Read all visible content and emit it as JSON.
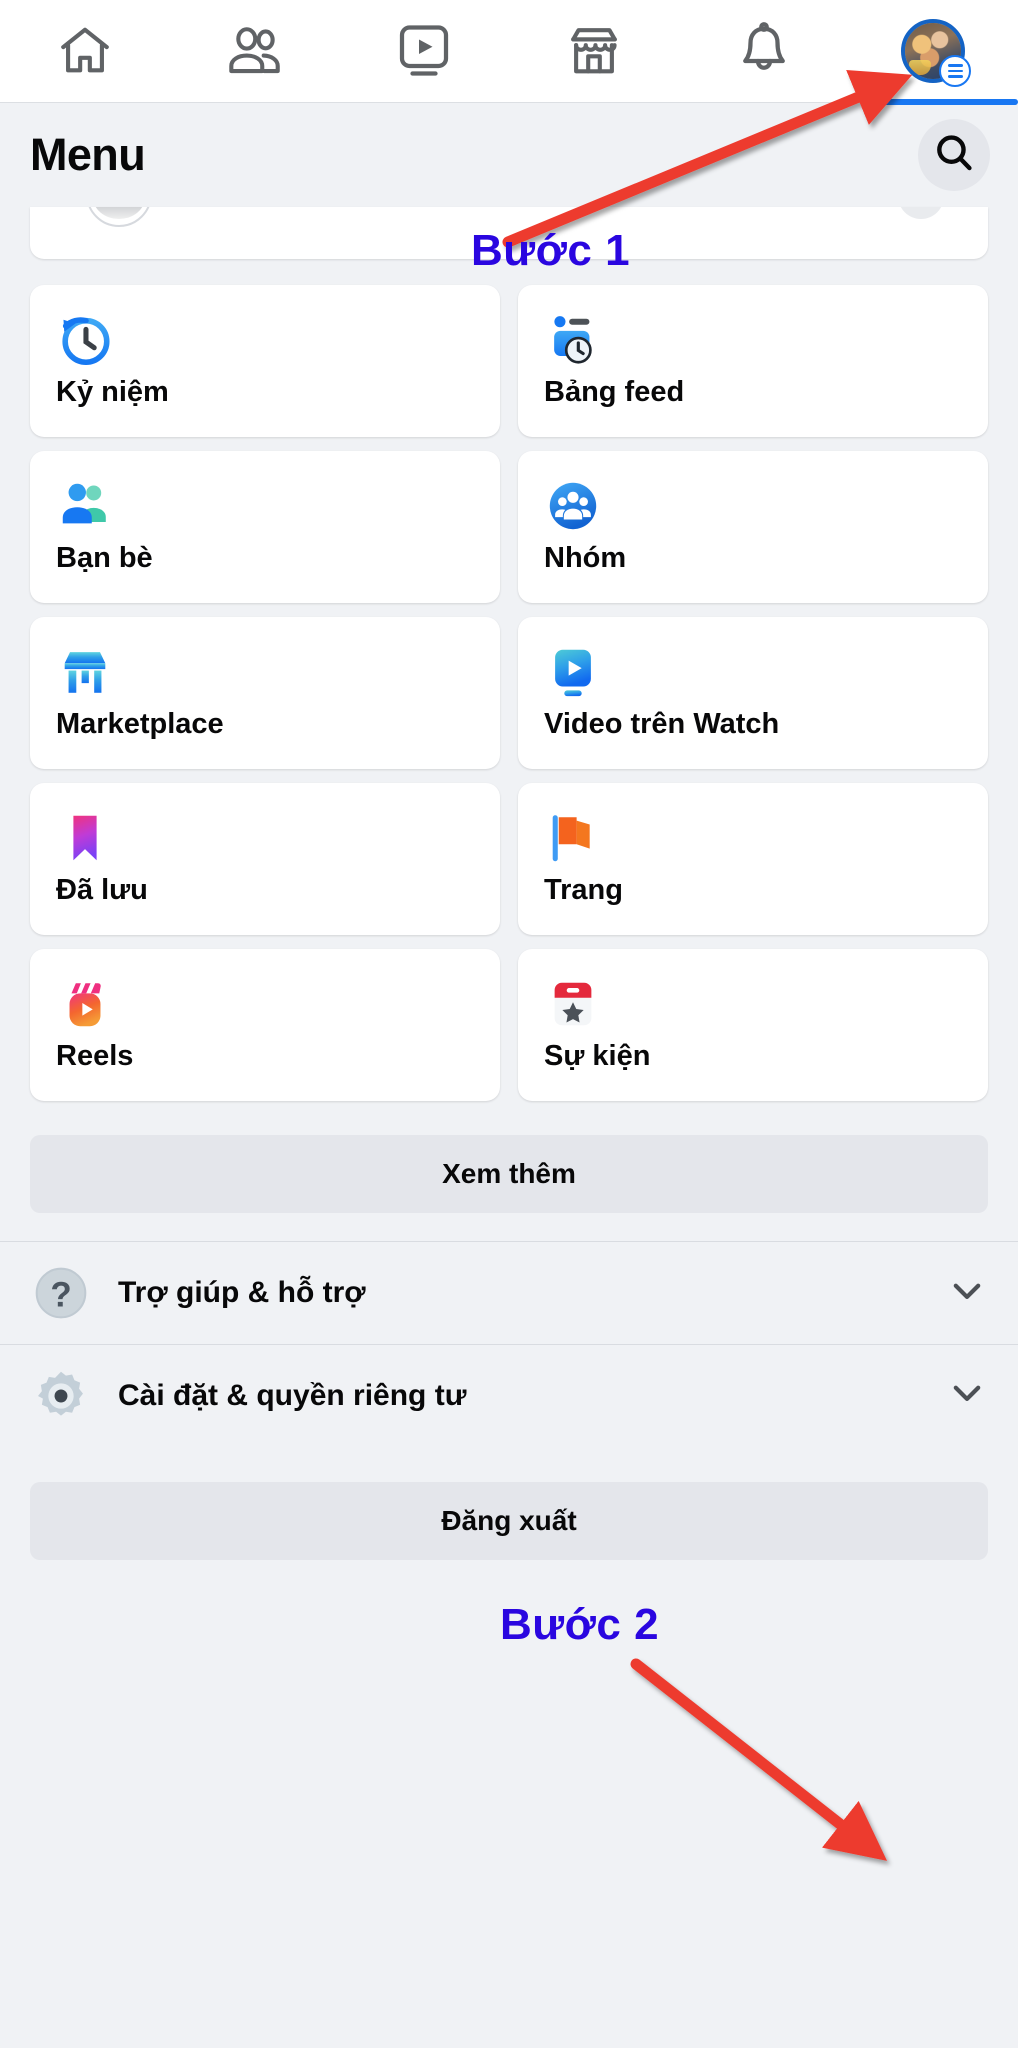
{
  "topnav": {
    "tabs": [
      {
        "name": "home-tab",
        "icon": "home-icon",
        "active": false
      },
      {
        "name": "friends-tab",
        "icon": "friends-icon",
        "active": false
      },
      {
        "name": "watch-tab",
        "icon": "video-play-icon",
        "active": false
      },
      {
        "name": "marketplace-tab",
        "icon": "storefront-icon",
        "active": false
      },
      {
        "name": "notifications-tab",
        "icon": "bell-icon",
        "active": false
      },
      {
        "name": "menu-tab",
        "icon": "avatar-menu-icon",
        "active": true
      }
    ],
    "icon_color": "#606366",
    "active_indicator_color": "#1877f2"
  },
  "header": {
    "title": "Menu",
    "search_icon": "search-icon"
  },
  "tiles": [
    {
      "label": "Kỷ niệm",
      "icon": "memories-clock-icon"
    },
    {
      "label": "Bảng feed",
      "icon": "feeds-icon"
    },
    {
      "label": "Bạn bè",
      "icon": "friends-people-icon"
    },
    {
      "label": "Nhóm",
      "icon": "groups-icon"
    },
    {
      "label": "Marketplace",
      "icon": "marketplace-storefront-icon"
    },
    {
      "label": "Video trên Watch",
      "icon": "watch-play-icon"
    },
    {
      "label": "Đã lưu",
      "icon": "saved-bookmark-icon"
    },
    {
      "label": "Trang",
      "icon": "pages-flag-icon"
    },
    {
      "label": "Reels",
      "icon": "reels-icon"
    },
    {
      "label": "Sự kiện",
      "icon": "events-calendar-icon"
    }
  ],
  "see_more": {
    "label": "Xem thêm"
  },
  "settings_list": [
    {
      "label": "Trợ giúp & hỗ trợ",
      "icon": "help-question-icon",
      "chevron": "chevron-down-icon"
    },
    {
      "label": "Cài đặt & quyền riêng tư",
      "icon": "settings-gear-icon",
      "chevron": "chevron-down-icon"
    }
  ],
  "logout": {
    "label": "Đăng xuất"
  },
  "annotations": [
    {
      "label": "Bước 1",
      "color": "#2a06e0"
    },
    {
      "label": "Bước 2",
      "color": "#2a06e0"
    }
  ],
  "colors": {
    "page_bg": "#f0f2f5",
    "card_bg": "#ffffff",
    "button_bg": "#e4e6eb",
    "brand_blue": "#1877f2",
    "annotation_purple": "#2a06e0",
    "arrow_red": "#ed3b2f",
    "text_primary": "#080809"
  }
}
